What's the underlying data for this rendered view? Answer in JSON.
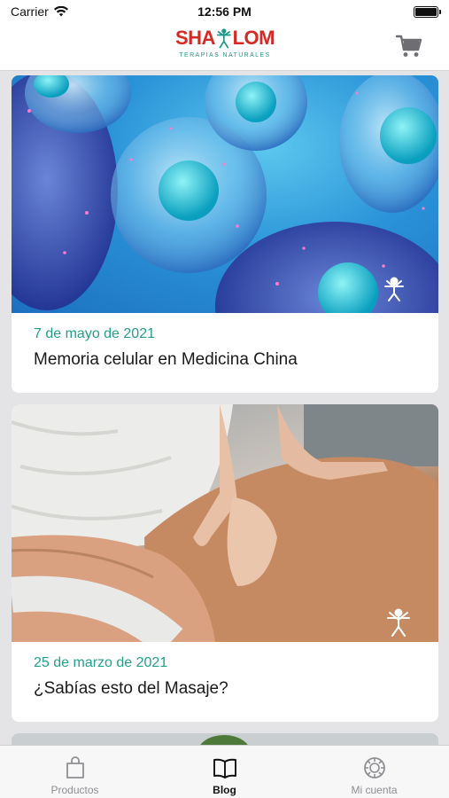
{
  "status_bar": {
    "carrier": "Carrier",
    "time": "12:56 PM"
  },
  "header": {
    "logo_left": "SHA",
    "logo_right": "LOM",
    "logo_subtitle": "TERAPIAS NATURALES",
    "cart_icon": "cart-icon"
  },
  "posts": [
    {
      "date": "7 de mayo de 2021",
      "title": "Memoria celular en Medicina China",
      "image": "cells-image"
    },
    {
      "date": "25 de marzo de 2021",
      "title": "¿Sabías esto del Masaje?",
      "image": "massage-image"
    }
  ],
  "tabs": [
    {
      "label": "Productos",
      "icon": "shopping-bag-icon",
      "active": false
    },
    {
      "label": "Blog",
      "icon": "book-icon",
      "active": true
    },
    {
      "label": "Mi cuenta",
      "icon": "account-icon",
      "active": false
    }
  ],
  "colors": {
    "brand_red": "#d42a23",
    "accent_green": "#22a08a"
  }
}
